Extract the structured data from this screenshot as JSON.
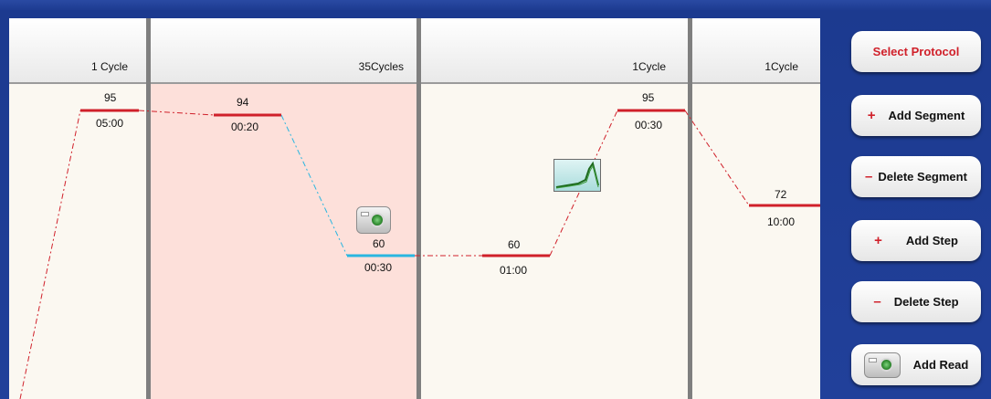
{
  "segments": [
    {
      "cycles": "1 Cycle"
    },
    {
      "cycles": "35Cycles"
    },
    {
      "cycles": "1Cycle"
    },
    {
      "cycles": "1Cycle"
    }
  ],
  "steps": [
    {
      "temp": "95",
      "time": "05:00"
    },
    {
      "temp": "94",
      "time": "00:20"
    },
    {
      "temp": "60",
      "time": "00:30"
    },
    {
      "temp": "60",
      "time": "01:00"
    },
    {
      "temp": "95",
      "time": "00:30"
    },
    {
      "temp": "72",
      "time": "10:00"
    }
  ],
  "buttons": {
    "select_protocol": "Select Protocol",
    "add_segment": "Add Segment",
    "delete_segment": "Delete Segment",
    "add_step": "Add Step",
    "delete_step": "Delete Step",
    "add_read": "Add Read",
    "plus": "+",
    "minus": "–"
  },
  "icons": {
    "read": "camera-icon",
    "melt_curve": "melt-curve-icon"
  },
  "colors": {
    "background": "#1f3d93",
    "step_line": "#d0202a",
    "selected_step_line": "#29b6e0",
    "selected_segment": "#fde0da",
    "button_text_accent": "#d0202a"
  }
}
